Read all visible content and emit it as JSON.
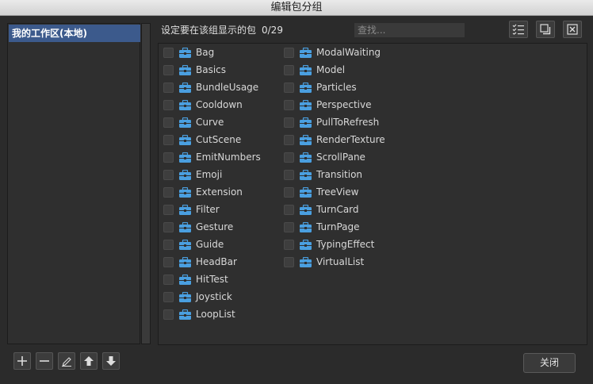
{
  "window": {
    "title": "编辑包分组"
  },
  "workspace": {
    "items": [
      {
        "label": "我的工作区(本地)"
      }
    ]
  },
  "header": {
    "label": "设定要在该组显示的包",
    "count": "0/29",
    "search_placeholder": "查找..."
  },
  "toolbar": {
    "select_all_icon": "checklist-icon",
    "restore_icon": "window-restore-icon",
    "clear_icon": "close-box-icon"
  },
  "packages": {
    "col1": [
      "Bag",
      "Basics",
      "BundleUsage",
      "Cooldown",
      "Curve",
      "CutScene",
      "EmitNumbers",
      "Emoji",
      "Extension",
      "Filter",
      "Gesture",
      "Guide",
      "HeadBar",
      "HitTest",
      "Joystick",
      "LoopList"
    ],
    "col2": [
      "ModalWaiting",
      "Model",
      "Particles",
      "Perspective",
      "PullToRefresh",
      "RenderTexture",
      "ScrollPane",
      "Transition",
      "TreeView",
      "TurnCard",
      "TurnPage",
      "TypingEffect",
      "VirtualList"
    ]
  },
  "bottom_toolbar": {
    "add_icon": "plus-icon",
    "remove_icon": "minus-icon",
    "rename_icon": "pencil-icon",
    "up_icon": "arrow-up-icon",
    "down_icon": "arrow-down-icon"
  },
  "footer": {
    "close_label": "关闭"
  },
  "colors": {
    "selection": "#3c5a8c",
    "package_icon": "#4a9fe0"
  }
}
